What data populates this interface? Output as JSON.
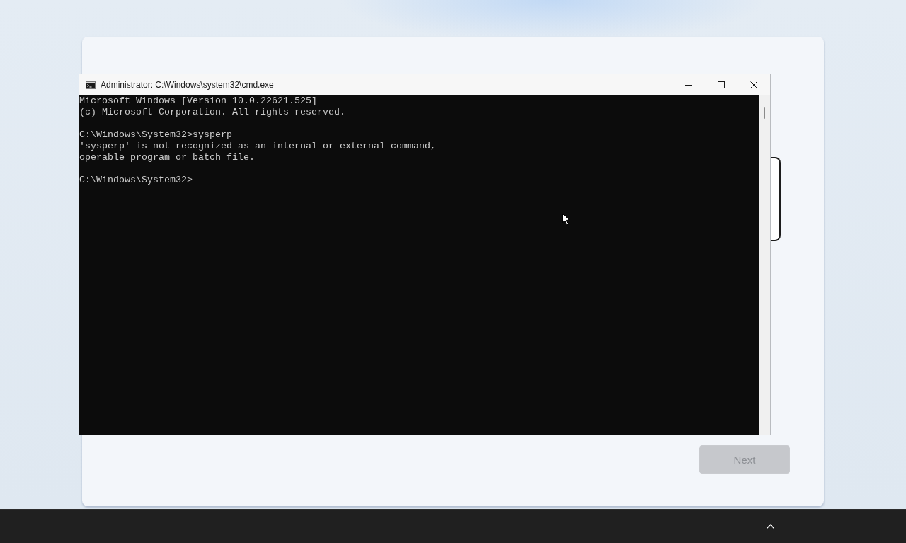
{
  "setup": {
    "next_button": {
      "label": "Next",
      "disabled": true
    }
  },
  "console_window": {
    "title": "Administrator: C:\\Windows\\system32\\cmd.exe",
    "blocks": [
      {
        "lines": [
          "Microsoft Windows [Version 10.0.22621.525]",
          "(c) Microsoft Corporation. All rights reserved."
        ]
      },
      {
        "lines": [
          "C:\\Windows\\System32>sysperp",
          "'sysperp' is not recognized as an internal or external command,",
          "operable program or batch file."
        ]
      },
      {
        "lines": [
          "C:\\Windows\\System32>"
        ]
      }
    ]
  }
}
